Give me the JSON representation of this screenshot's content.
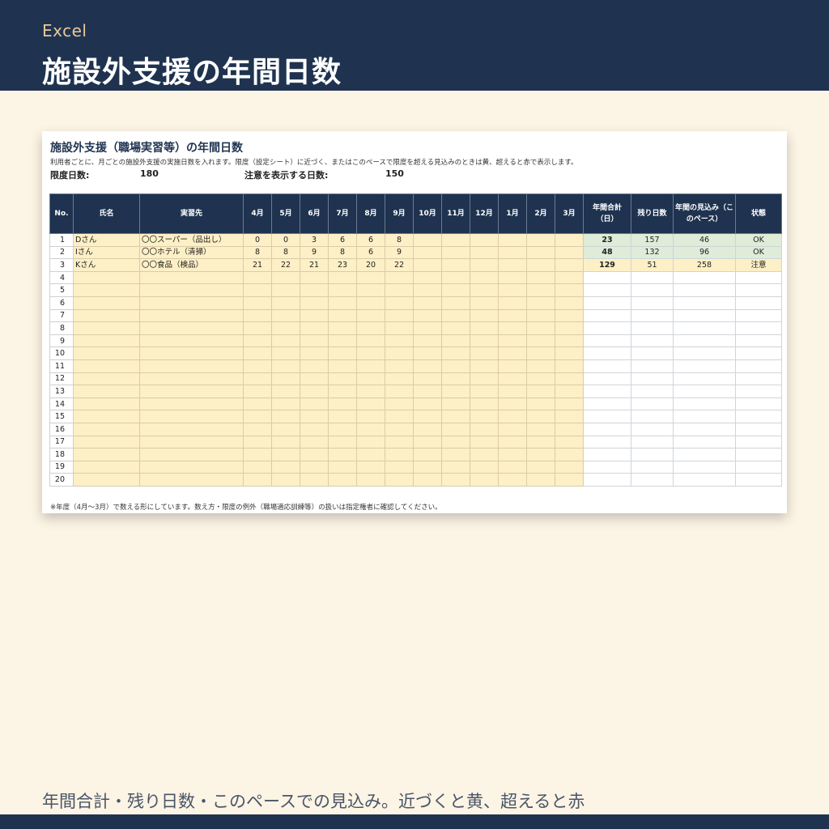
{
  "header": {
    "app": "Excel",
    "title": "施設外支援の年間日数"
  },
  "sheet": {
    "title": "施設外支援（職場実習等）の年間日数",
    "description": "利用者ごとに、月ごとの施設外支援の実施日数を入れます。限度（設定シート）に近づく、またはこのペースで限度を超える見込みのときは黄、超えると赤で表示します。",
    "limit_label": "限度日数:",
    "limit_value": "180",
    "warn_label": "注意を表示する日数:",
    "warn_value": "150",
    "columns": [
      "No.",
      "氏名",
      "実習先",
      "4月",
      "5月",
      "6月",
      "7月",
      "8月",
      "9月",
      "10月",
      "11月",
      "12月",
      "1月",
      "2月",
      "3月",
      "年間合計（日）",
      "残り日数",
      "年間の見込み（このペース）",
      "状態"
    ],
    "rows": [
      {
        "no": "1",
        "name": "Dさん",
        "place": "〇〇スーパー（品出し）",
        "months": [
          "0",
          "0",
          "3",
          "6",
          "6",
          "8",
          "",
          "",
          "",
          "",
          "",
          ""
        ],
        "total": "23",
        "remaining": "157",
        "forecast": "46",
        "status": "OK"
      },
      {
        "no": "2",
        "name": "Iさん",
        "place": "〇〇ホテル（清掃）",
        "months": [
          "8",
          "8",
          "9",
          "8",
          "6",
          "9",
          "",
          "",
          "",
          "",
          "",
          ""
        ],
        "total": "48",
        "remaining": "132",
        "forecast": "96",
        "status": "OK"
      },
      {
        "no": "3",
        "name": "Kさん",
        "place": "〇〇食品（検品）",
        "months": [
          "21",
          "22",
          "21",
          "23",
          "20",
          "22",
          "",
          "",
          "",
          "",
          "",
          ""
        ],
        "total": "129",
        "remaining": "51",
        "forecast": "258",
        "status": "注意"
      },
      {
        "no": "4",
        "name": "",
        "place": "",
        "months": [
          "",
          "",
          "",
          "",
          "",
          "",
          "",
          "",
          "",
          "",
          "",
          ""
        ],
        "total": "",
        "remaining": "",
        "forecast": "",
        "status": ""
      },
      {
        "no": "5",
        "name": "",
        "place": "",
        "months": [
          "",
          "",
          "",
          "",
          "",
          "",
          "",
          "",
          "",
          "",
          "",
          ""
        ],
        "total": "",
        "remaining": "",
        "forecast": "",
        "status": ""
      },
      {
        "no": "6",
        "name": "",
        "place": "",
        "months": [
          "",
          "",
          "",
          "",
          "",
          "",
          "",
          "",
          "",
          "",
          "",
          ""
        ],
        "total": "",
        "remaining": "",
        "forecast": "",
        "status": ""
      },
      {
        "no": "7",
        "name": "",
        "place": "",
        "months": [
          "",
          "",
          "",
          "",
          "",
          "",
          "",
          "",
          "",
          "",
          "",
          ""
        ],
        "total": "",
        "remaining": "",
        "forecast": "",
        "status": ""
      },
      {
        "no": "8",
        "name": "",
        "place": "",
        "months": [
          "",
          "",
          "",
          "",
          "",
          "",
          "",
          "",
          "",
          "",
          "",
          ""
        ],
        "total": "",
        "remaining": "",
        "forecast": "",
        "status": ""
      },
      {
        "no": "9",
        "name": "",
        "place": "",
        "months": [
          "",
          "",
          "",
          "",
          "",
          "",
          "",
          "",
          "",
          "",
          "",
          ""
        ],
        "total": "",
        "remaining": "",
        "forecast": "",
        "status": ""
      },
      {
        "no": "10",
        "name": "",
        "place": "",
        "months": [
          "",
          "",
          "",
          "",
          "",
          "",
          "",
          "",
          "",
          "",
          "",
          ""
        ],
        "total": "",
        "remaining": "",
        "forecast": "",
        "status": ""
      },
      {
        "no": "11",
        "name": "",
        "place": "",
        "months": [
          "",
          "",
          "",
          "",
          "",
          "",
          "",
          "",
          "",
          "",
          "",
          ""
        ],
        "total": "",
        "remaining": "",
        "forecast": "",
        "status": ""
      },
      {
        "no": "12",
        "name": "",
        "place": "",
        "months": [
          "",
          "",
          "",
          "",
          "",
          "",
          "",
          "",
          "",
          "",
          "",
          ""
        ],
        "total": "",
        "remaining": "",
        "forecast": "",
        "status": ""
      },
      {
        "no": "13",
        "name": "",
        "place": "",
        "months": [
          "",
          "",
          "",
          "",
          "",
          "",
          "",
          "",
          "",
          "",
          "",
          ""
        ],
        "total": "",
        "remaining": "",
        "forecast": "",
        "status": ""
      },
      {
        "no": "14",
        "name": "",
        "place": "",
        "months": [
          "",
          "",
          "",
          "",
          "",
          "",
          "",
          "",
          "",
          "",
          "",
          ""
        ],
        "total": "",
        "remaining": "",
        "forecast": "",
        "status": ""
      },
      {
        "no": "15",
        "name": "",
        "place": "",
        "months": [
          "",
          "",
          "",
          "",
          "",
          "",
          "",
          "",
          "",
          "",
          "",
          ""
        ],
        "total": "",
        "remaining": "",
        "forecast": "",
        "status": ""
      },
      {
        "no": "16",
        "name": "",
        "place": "",
        "months": [
          "",
          "",
          "",
          "",
          "",
          "",
          "",
          "",
          "",
          "",
          "",
          ""
        ],
        "total": "",
        "remaining": "",
        "forecast": "",
        "status": ""
      },
      {
        "no": "17",
        "name": "",
        "place": "",
        "months": [
          "",
          "",
          "",
          "",
          "",
          "",
          "",
          "",
          "",
          "",
          "",
          ""
        ],
        "total": "",
        "remaining": "",
        "forecast": "",
        "status": ""
      },
      {
        "no": "18",
        "name": "",
        "place": "",
        "months": [
          "",
          "",
          "",
          "",
          "",
          "",
          "",
          "",
          "",
          "",
          "",
          ""
        ],
        "total": "",
        "remaining": "",
        "forecast": "",
        "status": ""
      },
      {
        "no": "19",
        "name": "",
        "place": "",
        "months": [
          "",
          "",
          "",
          "",
          "",
          "",
          "",
          "",
          "",
          "",
          "",
          ""
        ],
        "total": "",
        "remaining": "",
        "forecast": "",
        "status": ""
      },
      {
        "no": "20",
        "name": "",
        "place": "",
        "months": [
          "",
          "",
          "",
          "",
          "",
          "",
          "",
          "",
          "",
          "",
          "",
          ""
        ],
        "total": "",
        "remaining": "",
        "forecast": "",
        "status": ""
      }
    ],
    "footnote": "※年度（4月〜3月）で数える形にしています。数え方・限度の例外（職場適応訓練等）の扱いは指定権者に確認してください。"
  },
  "caption": "年間合計・残り日数・このペースでの見込み。近づくと黄、超えると赤",
  "colors": {
    "navy": "#1f3350",
    "cream": "#fcf4e4",
    "input_fill": "#fdefc6",
    "ok_fill": "#deecd8",
    "accent": "#e8c99a"
  }
}
